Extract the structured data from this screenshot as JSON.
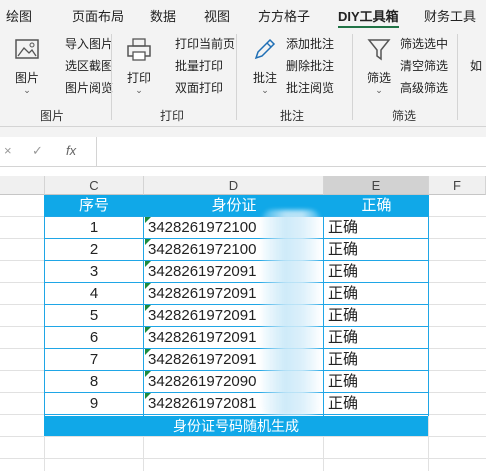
{
  "ribbon_tabs": [
    "绘图",
    "页面布局",
    "数据",
    "视图",
    "方方格子",
    "DIY工具箱",
    "财务工具"
  ],
  "active_tab": "DIY工具箱",
  "groups": {
    "picture": {
      "label": "图片",
      "big": "图片",
      "items": [
        "导入图片",
        "选区截图",
        "图片阅览"
      ]
    },
    "print": {
      "label": "打印",
      "big": "打印",
      "items": [
        "打印当前页",
        "批量打印",
        "双面打印"
      ]
    },
    "comment": {
      "label": "批注",
      "big": "批注",
      "items": [
        "添加批注",
        "删除批注",
        "批注阅览"
      ]
    },
    "filter": {
      "label": "筛选",
      "big": "筛选",
      "items": [
        "筛选选中",
        "清空筛选",
        "高级筛选"
      ]
    },
    "cut_off_label": "如"
  },
  "formula_bar": {
    "cancel": "×",
    "confirm": "✓",
    "fx": "fx",
    "value": ""
  },
  "columns": [
    "C",
    "D",
    "E",
    "F"
  ],
  "selected_column": "E",
  "table": {
    "headers": [
      "序号",
      "身份证",
      "正确"
    ],
    "rows": [
      {
        "no": "1",
        "id": "3428261972100",
        "status": "正确"
      },
      {
        "no": "2",
        "id": "3428261972100",
        "status": "正确"
      },
      {
        "no": "3",
        "id": "3428261972091",
        "status": "正确"
      },
      {
        "no": "4",
        "id": "3428261972091",
        "status": "正确"
      },
      {
        "no": "5",
        "id": "3428261972091",
        "status": "正确"
      },
      {
        "no": "6",
        "id": "3428261972091",
        "status": "正确"
      },
      {
        "no": "7",
        "id": "3428261972091",
        "status": "正确"
      },
      {
        "no": "8",
        "id": "3428261972090",
        "status": "正确"
      },
      {
        "no": "9",
        "id": "3428261972081",
        "status": "正确"
      }
    ],
    "footer": "身份证号码随机生成"
  },
  "colors": {
    "accent": "#10a8e8",
    "ribbon_bg": "#f3f3f3",
    "active_underline": "#217346",
    "error_triangle": "#1a8a3e"
  }
}
